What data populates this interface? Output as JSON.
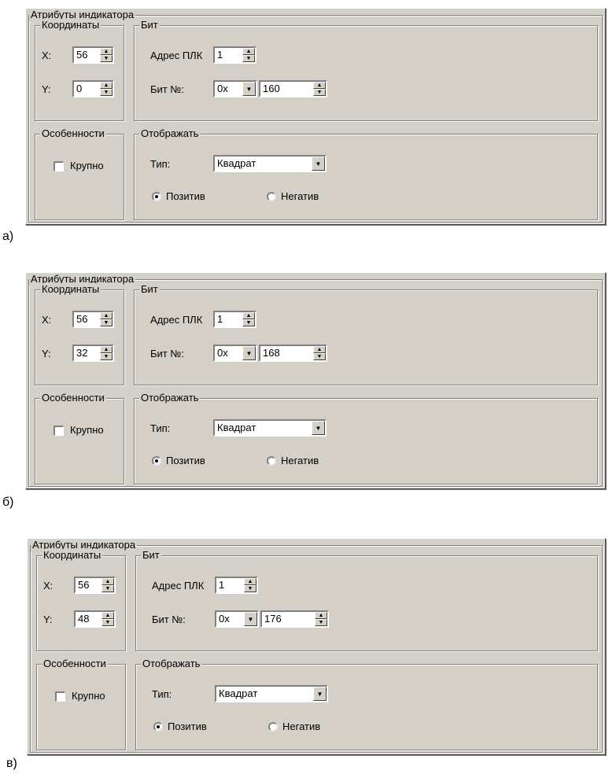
{
  "dialogs": [
    {
      "caption": "а)",
      "group_title": "Атрибуты индикатора",
      "coords": {
        "title": "Координаты",
        "x_label": "X:",
        "x_value": "56",
        "y_label": "Y:",
        "y_value": "0"
      },
      "bit": {
        "title": "Бит",
        "plc_label": "Адрес ПЛК",
        "plc_value": "1",
        "bitno_label": "Бит №:",
        "prefix_value": "0x",
        "bit_value": "160"
      },
      "features": {
        "title": "Особенности",
        "large_label": "Крупно"
      },
      "display": {
        "title": "Отображать",
        "type_label": "Тип:",
        "type_value": "Квадрат",
        "positive_label": "Позитив",
        "negative_label": "Негатив"
      }
    },
    {
      "caption": "б)",
      "group_title": "Атрибуты индикатора",
      "coords": {
        "title": "Координаты",
        "x_label": "X:",
        "x_value": "56",
        "y_label": "Y:",
        "y_value": "32"
      },
      "bit": {
        "title": "Бит",
        "plc_label": "Адрес ПЛК",
        "plc_value": "1",
        "bitno_label": "Бит №:",
        "prefix_value": "0x",
        "bit_value": "168"
      },
      "features": {
        "title": "Особенности",
        "large_label": "Крупно"
      },
      "display": {
        "title": "Отображать",
        "type_label": "Тип:",
        "type_value": "Квадрат",
        "positive_label": "Позитив",
        "negative_label": "Негатив"
      }
    },
    {
      "caption": "в)",
      "group_title": "Атрибуты индикатора",
      "coords": {
        "title": "Координаты",
        "x_label": "X:",
        "x_value": "56",
        "y_label": "Y:",
        "y_value": "48"
      },
      "bit": {
        "title": "Бит",
        "plc_label": "Адрес ПЛК",
        "plc_value": "1",
        "bitno_label": "Бит №:",
        "prefix_value": "0x",
        "bit_value": "176"
      },
      "features": {
        "title": "Особенности",
        "large_label": "Крупно"
      },
      "display": {
        "title": "Отображать",
        "type_label": "Тип:",
        "type_value": "Квадрат",
        "positive_label": "Позитив",
        "negative_label": "Негатив"
      }
    }
  ],
  "icons": {
    "spin": "up-down-arrows",
    "combo": "chevron-down",
    "radio_selected": "positive"
  }
}
